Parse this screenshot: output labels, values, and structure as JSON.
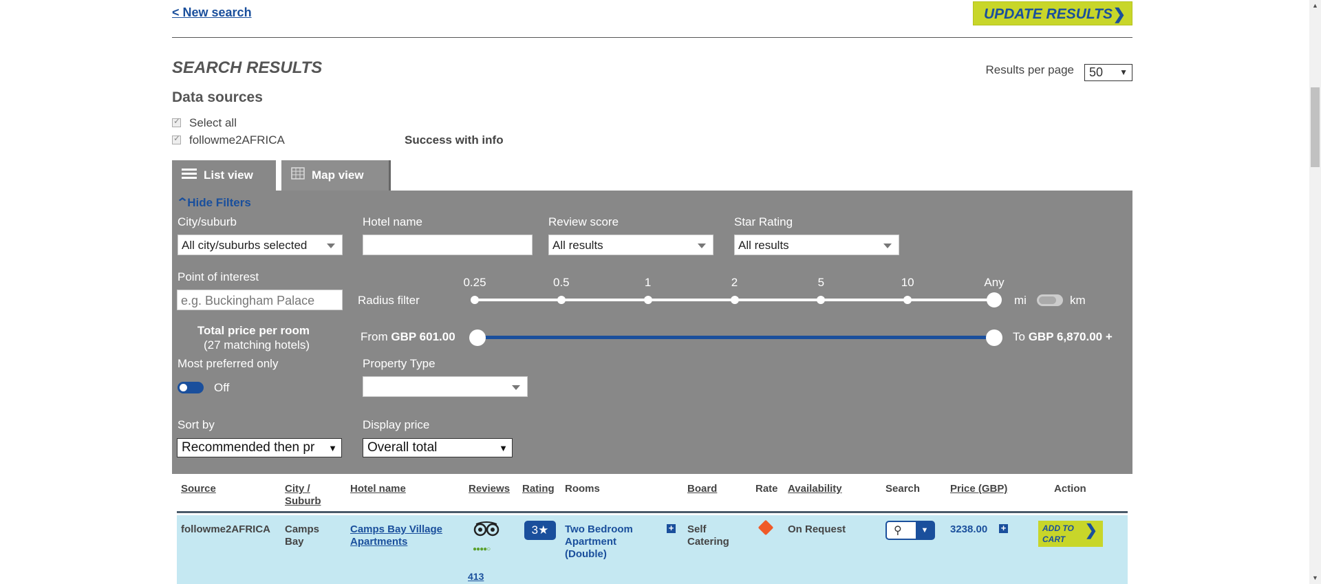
{
  "nav": {
    "new_search": "< New search",
    "update_results": "UPDATE RESULTS"
  },
  "header": {
    "title": "SEARCH RESULTS",
    "results_per_page_label": "Results per page",
    "results_per_page_value": "50"
  },
  "data_sources": {
    "title": "Data sources",
    "select_all": "Select all",
    "source": "followme2AFRICA",
    "status": "Success with info"
  },
  "tabs": [
    {
      "label": "List view"
    },
    {
      "label": "Map view"
    }
  ],
  "filters": {
    "hide_filters": "Hide Filters",
    "city_label": "City/suburb",
    "city_value": "All city/suburbs selected",
    "hotel_label": "Hotel name",
    "hotel_value": "",
    "review_label": "Review score",
    "review_value": "All results",
    "star_label": "Star Rating",
    "star_value": "All results",
    "poi_label": "Point of interest",
    "poi_placeholder": "e.g. Buckingham Palace",
    "radius_label": "Radius filter",
    "radius_ticks": [
      "0.25",
      "0.5",
      "1",
      "2",
      "5",
      "10",
      "Any"
    ],
    "radius_selected": "Any",
    "unit_mi": "mi",
    "unit_km": "km",
    "total_price_label": "Total price per room",
    "matching_hotels": "(27 matching hotels)",
    "from_prefix": "From",
    "from_value": "GBP 601.00",
    "to_prefix": "To",
    "to_value": "GBP 6,870.00 +",
    "preferred_label": "Most preferred only",
    "preferred_state": "Off",
    "property_label": "Property Type",
    "property_value": "",
    "sort_label": "Sort by",
    "sort_value": "Recommended then pr",
    "display_price_label": "Display price",
    "display_price_value": "Overall total"
  },
  "table": {
    "columns": [
      "Source",
      "City / Suburb",
      "Hotel name",
      "Reviews",
      "Rating",
      "Rooms",
      "Board",
      "Rate",
      "Availability",
      "Search",
      "Price (GBP)",
      "Action"
    ],
    "rows": [
      {
        "source": "followme2AFRICA",
        "city": "Camps Bay",
        "hotel": "Camps Bay Village Apartments",
        "reviews_count": "413 Reviews",
        "rating": "3★",
        "room": "Two Bedroom Apartment (Double)",
        "board": "Self Catering",
        "availability": "On Request",
        "price": "3238.00",
        "action": "ADD TO CART"
      }
    ]
  },
  "colors": {
    "accent": "#c8d62a",
    "brand_blue": "#1a4f9c",
    "panel": "#888888",
    "row_bg": "#c5e8f2"
  }
}
